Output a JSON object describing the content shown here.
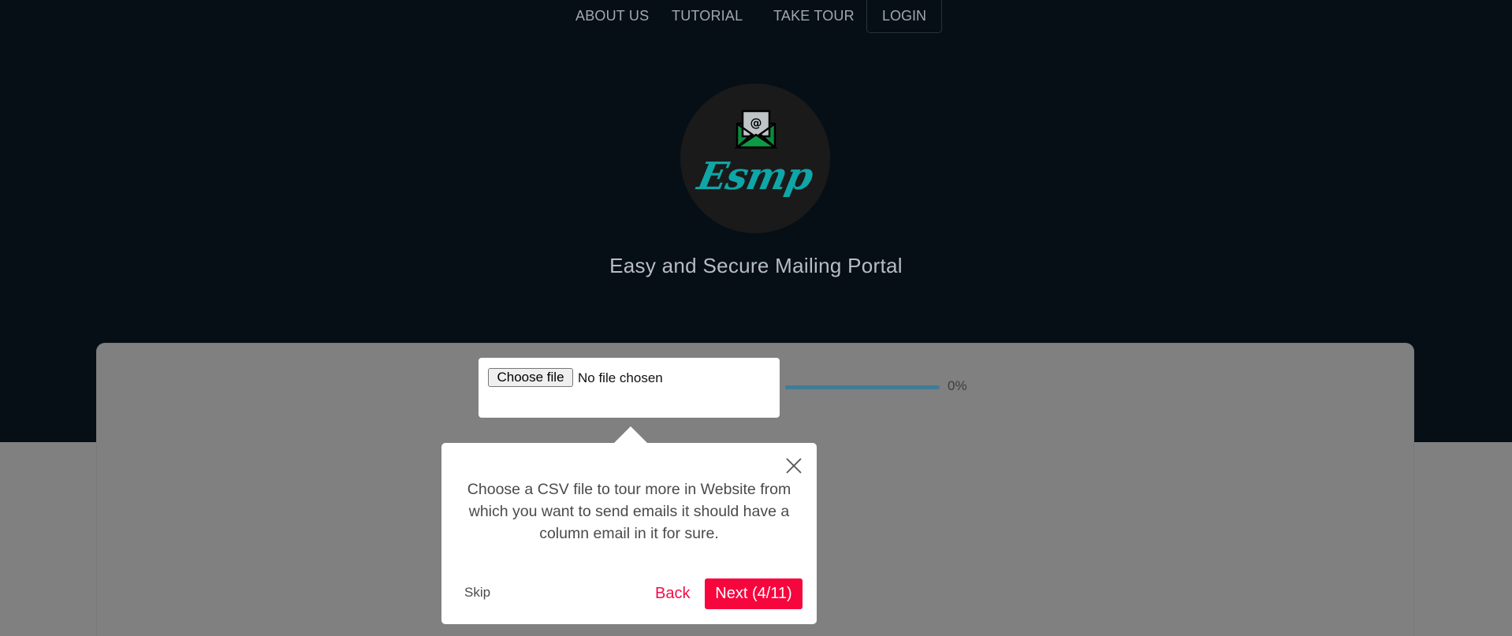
{
  "nav": {
    "about": "ABOUT US",
    "tutorial": "TUTORIAL",
    "tour": "TAKE TOUR",
    "login": "LOGIN"
  },
  "logo": {
    "text": "Esmp",
    "icon": "envelope-at-icon"
  },
  "tagline": "Easy and Secure Mailing Portal",
  "upload": {
    "button_label": "Choose file",
    "status": "No file chosen",
    "progress_text": "0%",
    "progress": 0
  },
  "popover": {
    "text": "Choose a CSV file to tour more in Website from which you want to send emails it should have a column email in it for sure.",
    "skip": "Skip",
    "back": "Back",
    "next": "Next (4/11)",
    "close_icon": "close-icon"
  },
  "colors": {
    "hero_bg": "#060f16",
    "overlay": "#808080",
    "accent": "#f7063e",
    "logo_text": "#0fa6a8",
    "progress": "#3e7d96"
  }
}
